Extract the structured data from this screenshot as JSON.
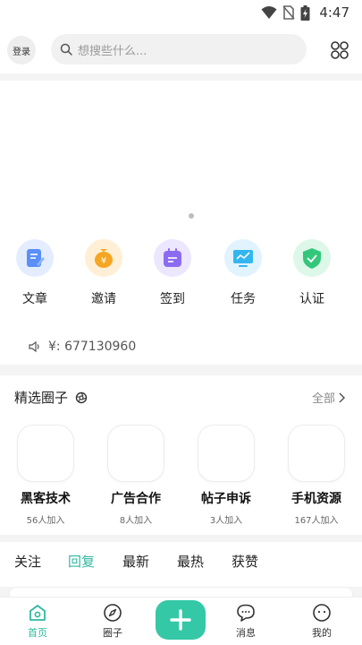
{
  "status_bar": {
    "time": "4:47"
  },
  "header": {
    "login_label": "登录",
    "search_placeholder": "想搜些什么..."
  },
  "quick_actions": [
    {
      "label": "文章",
      "icon": "article-icon",
      "color": "#5b8ff9"
    },
    {
      "label": "邀请",
      "icon": "invite-coin-icon",
      "color": "#f5a623"
    },
    {
      "label": "签到",
      "icon": "calendar-icon",
      "color": "#8b6cf0"
    },
    {
      "label": "任务",
      "icon": "monitor-icon",
      "color": "#33b6ef"
    },
    {
      "label": "认证",
      "icon": "shield-check-icon",
      "color": "#34c77b"
    }
  ],
  "notice": {
    "text": "¥: 677130960"
  },
  "circles": {
    "title": "精选圈子",
    "all_label": "全部",
    "items": [
      {
        "name": "黑客技术",
        "count": "56人加入"
      },
      {
        "name": "广告合作",
        "count": "8人加入"
      },
      {
        "name": "帖子申诉",
        "count": "3人加入"
      },
      {
        "name": "手机资源",
        "count": "167人加入"
      }
    ]
  },
  "feed_tabs": [
    {
      "label": "关注",
      "active": false
    },
    {
      "label": "回复",
      "active": true
    },
    {
      "label": "最新",
      "active": false
    },
    {
      "label": "最热",
      "active": false
    },
    {
      "label": "获赞",
      "active": false
    }
  ],
  "bottom_nav": [
    {
      "label": "首页",
      "icon": "home-icon",
      "active": true
    },
    {
      "label": "圈子",
      "icon": "compass-icon",
      "active": false
    },
    {
      "label": "消息",
      "icon": "chat-icon",
      "active": false
    },
    {
      "label": "我的",
      "icon": "profile-icon",
      "active": false
    }
  ],
  "colors": {
    "accent": "#35c8a6",
    "accent_text": "#2fb8a0"
  }
}
